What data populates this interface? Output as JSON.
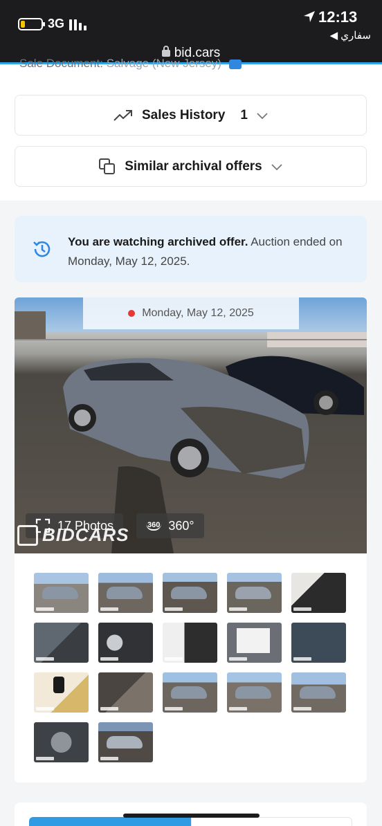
{
  "status_bar": {
    "network": "3G",
    "time": "12:13",
    "back_app": "◀ سفاري",
    "url": "bid.cars"
  },
  "cutoff_line": {
    "label": "Sale Document:",
    "value": "Salvage (New Jersey)"
  },
  "accordions": {
    "sales_history": {
      "label": "Sales History",
      "count": "1",
      "icon": "trending-up-icon"
    },
    "similar_offers": {
      "label": "Similar archival offers",
      "icon": "copy-icon"
    }
  },
  "archived_notice": {
    "bold": "You are watching archived offer.",
    "rest": " Auction ended on Monday, May 12, 2025."
  },
  "gallery": {
    "date": "Monday, May 12, 2025",
    "photos_label": "17 Photos",
    "three60_icon_text": "360",
    "three60_label": "360°",
    "watermark": "BIDCARS"
  },
  "colors": {
    "accent": "#2f9be5",
    "notice_bg": "#e8f2fc",
    "status_bar": "#1c1c1e",
    "live_dot": "#e53935"
  }
}
